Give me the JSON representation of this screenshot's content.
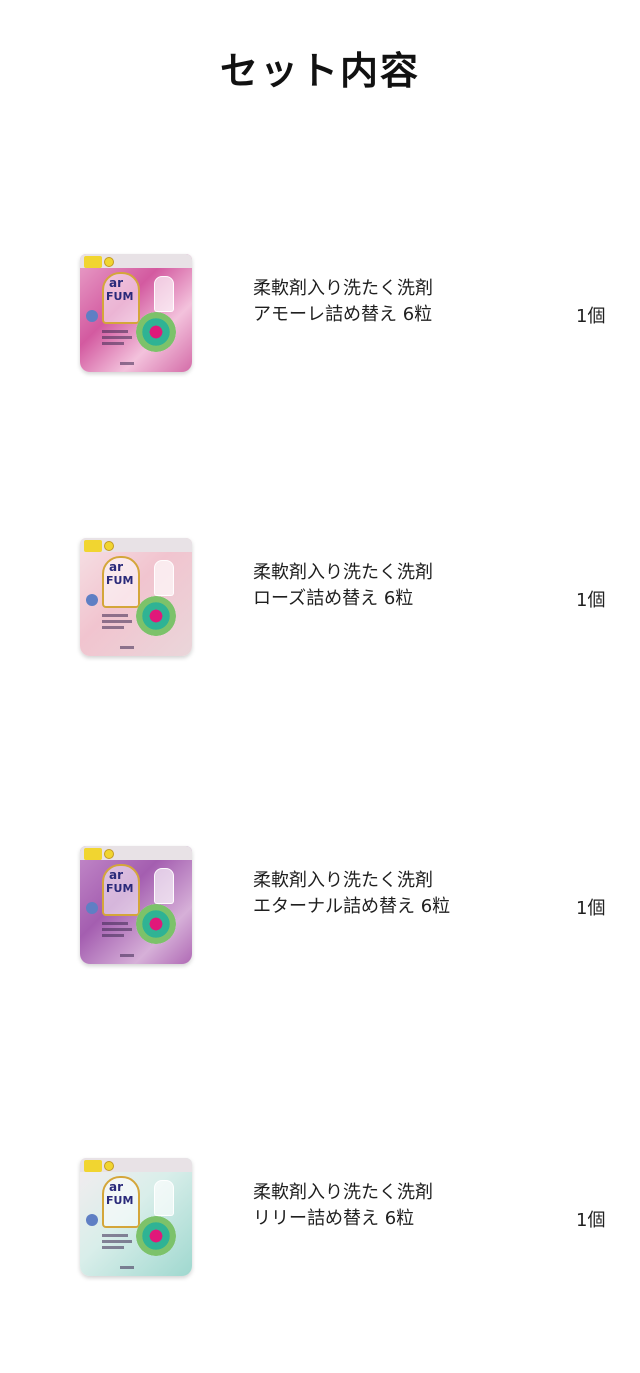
{
  "page": {
    "title": "セット内容"
  },
  "items": [
    {
      "line1": "柔軟剤入り洗たく洗剤",
      "line2": "アモーレ詰め替え 6粒",
      "qty": "1個",
      "image": "product-pouch-amore"
    },
    {
      "line1": "柔軟剤入り洗たく洗剤",
      "line2": "ローズ詰め替え 6粒",
      "qty": "1個",
      "image": "product-pouch-rose"
    },
    {
      "line1": "柔軟剤入り洗たく洗剤",
      "line2": "エターナル詰め替え 6粒",
      "qty": "1個",
      "image": "product-pouch-eternal"
    },
    {
      "line1": "柔軟剤入り洗たく洗剤",
      "line2": "リリー詰め替え 6粒",
      "qty": "1個",
      "image": "product-pouch-lily"
    }
  ],
  "colors": {
    "amore": "#d35aa0",
    "rose": "#f1c4cf",
    "eternal": "#a45eb0",
    "lily": "#9fd8cf"
  }
}
